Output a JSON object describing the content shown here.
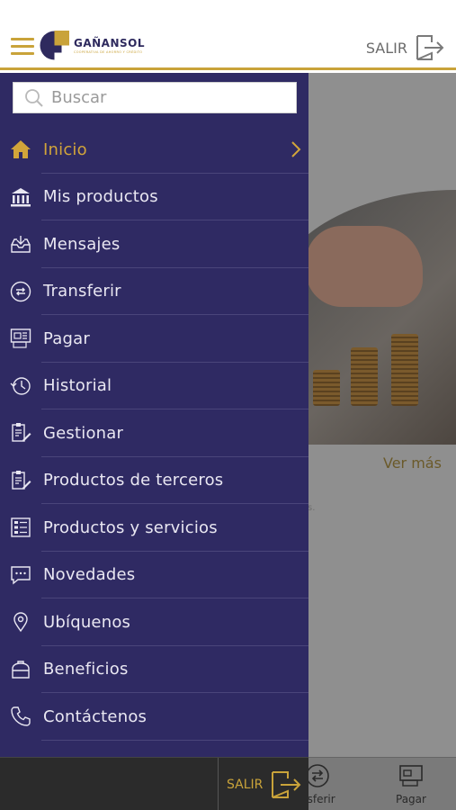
{
  "header": {
    "logo_name": "GAÑANSOL",
    "logo_tagline": "COOPERATIVA DE AHORRO Y CRÉDITO",
    "salir_label": "SALIR"
  },
  "search": {
    "placeholder": "Buscar"
  },
  "menu": {
    "items": [
      {
        "label": "Inicio",
        "icon": "home-icon",
        "active": true
      },
      {
        "label": "Mis productos",
        "icon": "bank-icon"
      },
      {
        "label": "Mensajes",
        "icon": "inbox-icon"
      },
      {
        "label": "Transferir",
        "icon": "transfer-icon"
      },
      {
        "label": "Pagar",
        "icon": "pay-icon"
      },
      {
        "label": "Historial",
        "icon": "history-icon"
      },
      {
        "label": "Gestionar",
        "icon": "manage-icon"
      },
      {
        "label": "Productos de terceros",
        "icon": "third-party-icon"
      },
      {
        "label": "Productos y servicios",
        "icon": "services-icon"
      },
      {
        "label": "Novedades",
        "icon": "news-icon"
      },
      {
        "label": "Ubíquenos",
        "icon": "location-icon"
      },
      {
        "label": "Beneficios",
        "icon": "benefits-icon"
      },
      {
        "label": "Contáctenos",
        "icon": "phone-icon"
      }
    ]
  },
  "drawer_footer": {
    "salir_label": "SALIR"
  },
  "background": {
    "ver_mas": "Ver más",
    "partial_text": "s."
  },
  "bottom_nav": {
    "transferir_label": "nsferir",
    "pagar_label": "Pagar"
  },
  "colors": {
    "drawer_bg": "#2f2a63",
    "accent_gold": "#c9a33a",
    "header_rule": "#c9a33a"
  }
}
